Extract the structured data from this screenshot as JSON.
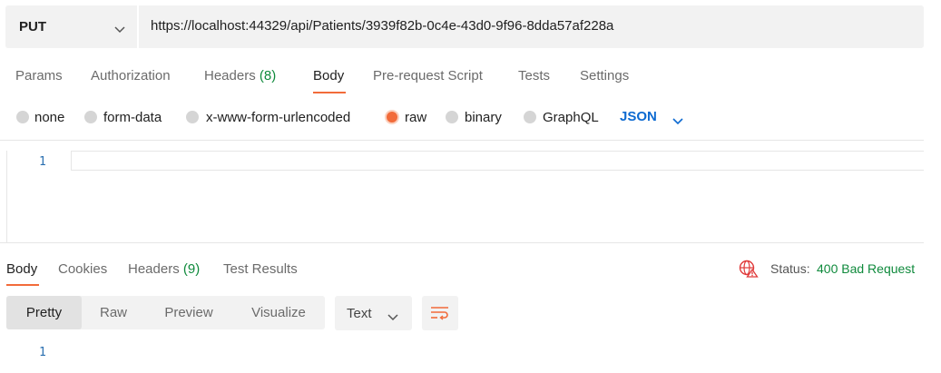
{
  "request": {
    "method": "PUT",
    "url": "https://localhost:44329/api/Patients/3939f82b-0c4e-43d0-9f96-8dda57af228a"
  },
  "request_tabs": {
    "params": "Params",
    "authorization": "Authorization",
    "headers": "Headers",
    "headers_count": "(8)",
    "body": "Body",
    "prerequest": "Pre-request Script",
    "tests": "Tests",
    "settings": "Settings",
    "active": "Body"
  },
  "body_types": {
    "none": "none",
    "form_data": "form-data",
    "urlencoded": "x-www-form-urlencoded",
    "raw": "raw",
    "binary": "binary",
    "graphql": "GraphQL",
    "selected": "raw",
    "raw_format": "JSON"
  },
  "editor": {
    "line_number": "1"
  },
  "response_tabs": {
    "body": "Body",
    "cookies": "Cookies",
    "headers": "Headers",
    "headers_count": "(9)",
    "test_results": "Test Results",
    "active": "Body"
  },
  "status": {
    "label": "Status:",
    "value": "400 Bad Request"
  },
  "response_view": {
    "pretty": "Pretty",
    "raw": "Raw",
    "preview": "Preview",
    "visualize": "Visualize",
    "active": "Pretty",
    "format": "Text"
  },
  "response_editor": {
    "line_number": "1"
  },
  "colors": {
    "accent": "#f26b3a",
    "success": "#0f8a3c",
    "link": "#0d6ad1",
    "error_icon": "#e03a3a"
  },
  "icons": {
    "method_dropdown": "chevron-down-icon",
    "json_dropdown": "chevron-down-icon",
    "network_error": "globe-warning-icon",
    "wrap": "wrap-lines-icon",
    "text_dropdown": "chevron-down-icon"
  }
}
